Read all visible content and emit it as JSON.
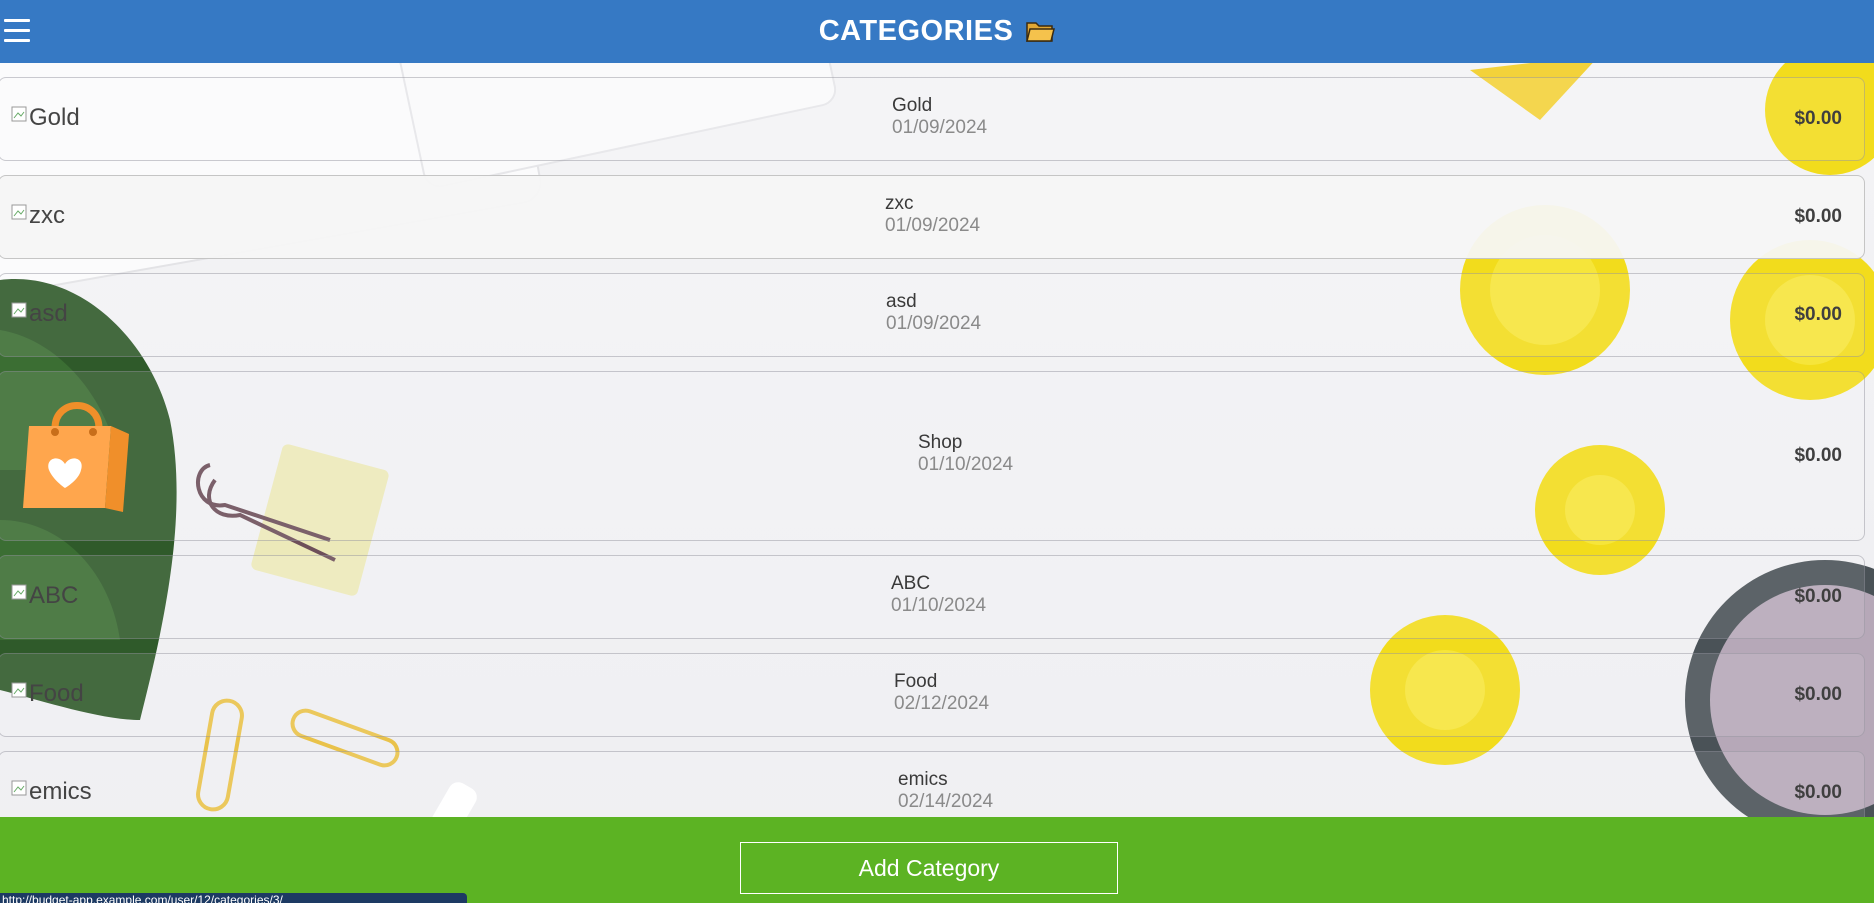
{
  "header": {
    "title": "CATEGORIES"
  },
  "categories": [
    {
      "alt": "Gold",
      "name": "Gold",
      "date": "01/09/2024",
      "amount": "$0.00",
      "has_image": false,
      "selected": false
    },
    {
      "alt": "zxc",
      "name": "zxc",
      "date": "01/09/2024",
      "amount": "$0.00",
      "has_image": false,
      "selected": true
    },
    {
      "alt": "asd",
      "name": "asd",
      "date": "01/09/2024",
      "amount": "$0.00",
      "has_image": false,
      "selected": false
    },
    {
      "alt": "Shop",
      "name": "Shop",
      "date": "01/10/2024",
      "amount": "$0.00",
      "has_image": true,
      "selected": false
    },
    {
      "alt": "ABC",
      "name": "ABC",
      "date": "01/10/2024",
      "amount": "$0.00",
      "has_image": false,
      "selected": false
    },
    {
      "alt": "Food",
      "name": "Food",
      "date": "02/12/2024",
      "amount": "$0.00",
      "has_image": false,
      "selected": false
    },
    {
      "alt": "emics",
      "name": "emics",
      "date": "02/14/2024",
      "amount": "$0.00",
      "has_image": false,
      "selected": false
    }
  ],
  "footer": {
    "add_label": "Add Category"
  },
  "status_bar": {
    "url": "http://budget-app.example.com/user/12/categories/3/"
  },
  "icons": {
    "menu": "hamburger-icon",
    "folder": "folder-icon",
    "shop_image": "shopping-bag-heart-icon"
  },
  "colors": {
    "header": "#3679c4",
    "footer": "#5cb323",
    "folder": "#f5c24c",
    "bag": "#ffa64d"
  }
}
